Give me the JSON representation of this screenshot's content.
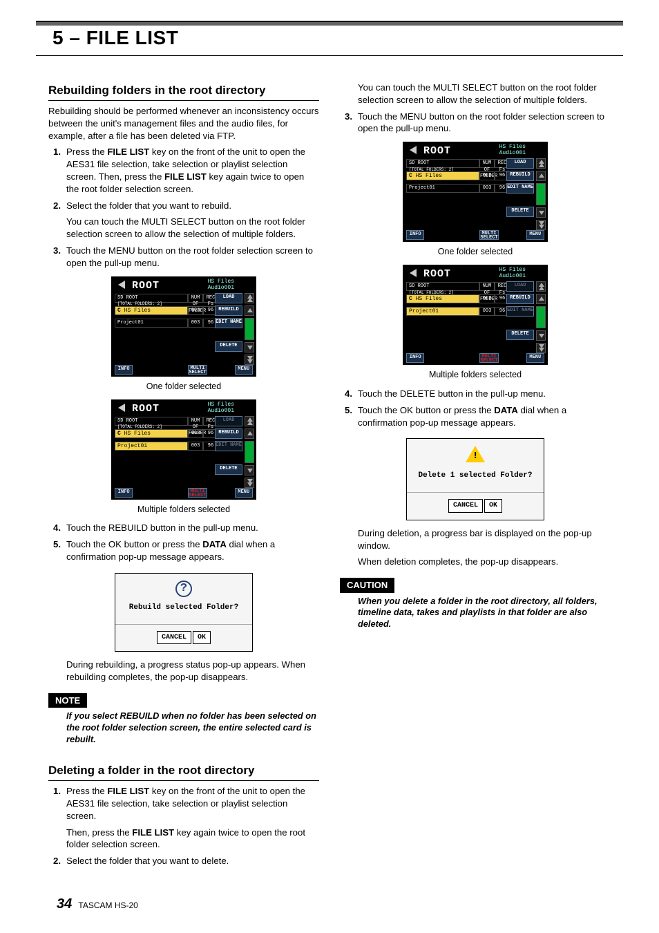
{
  "chapter": "5 – FILE LIST",
  "left": {
    "h2_rebuild": "Rebuilding folders in the root directory",
    "intro": "Rebuilding should be performed whenever an inconsistency occurs between the unit's management files and the audio files, for example, after a file has been deleted via FTP.",
    "steps_a": {
      "s1": {
        "num": "1",
        "p1a": "Press the ",
        "p1b": "FILE LIST",
        "p1c": " key on the front of the unit to open the AES31 file selection, take selection or playlist selection screen. Then, press the ",
        "p1d": "FILE LIST",
        "p1e": " key again twice to open the root folder selection screen."
      },
      "s2": {
        "num": "2",
        "p1": "Select the folder that you want to rebuild.",
        "p2": "You can touch the MULTI SELECT button on the root folder selection screen to allow the selection of multiple folders."
      },
      "s3": {
        "num": "3",
        "p1": "Touch the MENU button on the root folder selection screen to open the pull-up menu."
      }
    },
    "cap1": "One folder selected",
    "cap2": "Multiple folders selected",
    "steps_b": {
      "s4": {
        "num": "4",
        "p1": "Touch the REBUILD button in the pull-up menu."
      },
      "s5": {
        "num": "5",
        "p1a": "Touch the OK button or press the ",
        "p1b": "DATA",
        "p1c": " dial when a confirmation pop-up message appears."
      }
    },
    "dialog_q": {
      "msg": "Rebuild selected Folder?",
      "cancel": "CANCEL",
      "ok": "OK"
    },
    "after_dialog": "During rebuilding, a progress status pop-up appears. When rebuilding completes, the pop-up disappears.",
    "note_label": "NOTE",
    "note_body": "If you select REBUILD when no folder has been selected on the root folder selection screen, the entire selected card is rebuilt.",
    "h2_delete": "Deleting a folder in the root directory",
    "steps_c": {
      "s1": {
        "num": "1",
        "p1a": "Press the ",
        "p1b": "FILE LIST",
        "p1c": " key on the front of the unit to open the AES31 file selection, take selection or playlist selection screen.",
        "p2a": "Then, press the ",
        "p2b": "FILE LIST",
        "p2c": " key again twice to open the root folder selection screen."
      },
      "s2": {
        "num": "2",
        "p1": "Select the folder that you want to delete."
      }
    }
  },
  "right": {
    "cont": "You can touch the MULTI SELECT button on the root folder selection screen to allow the selection of multiple folders.",
    "s3": {
      "num": "3",
      "p1": "Touch the MENU button on the root folder selection screen to open the pull-up menu."
    },
    "cap1": "One folder selected",
    "cap2": "Multiple folders selected",
    "s4": {
      "num": "4",
      "p1": "Touch the DELETE button in the pull-up menu."
    },
    "s5": {
      "num": "5",
      "p1a": "Touch the OK button or press the ",
      "p1b": "DATA",
      "p1c": " dial when a confirmation pop-up message appears."
    },
    "dialog_w": {
      "msg": "Delete 1 selected Folder?",
      "cancel": "CANCEL",
      "ok": "OK"
    },
    "after1": "During deletion, a progress bar is displayed on the pop-up window.",
    "after2": "When deletion completes, the pop-up disappears.",
    "caution_label": "CAUTION",
    "caution_body": "When you delete a folder in the root directory, all folders, timeline data, takes and playlists in that folder are also deleted."
  },
  "fig": {
    "title": "ROOT",
    "breadcrumb1": "HS Files",
    "breadcrumb2": "Audio001",
    "row_root_a": "SD ROOT",
    "row_root_b": "[TOTAL FOLDERS: 2]",
    "row_hs": "HS Files",
    "row_proj": "Project01",
    "col_c": "C",
    "col_003": "003",
    "col_96": "96",
    "hdr_folder": "NUM\nOF\nFOLDER",
    "hdr_fs": "REC\nFs",
    "menu_load": "LOAD",
    "menu_rebuild": "REBUILD",
    "menu_edit": "EDIT\nNAME",
    "menu_delete": "DELETE",
    "info": "INFO",
    "multi": "MULTI\nSELECT",
    "menu": "MENU"
  },
  "footer": {
    "page": "34",
    "model": "TASCAM HS-20"
  }
}
